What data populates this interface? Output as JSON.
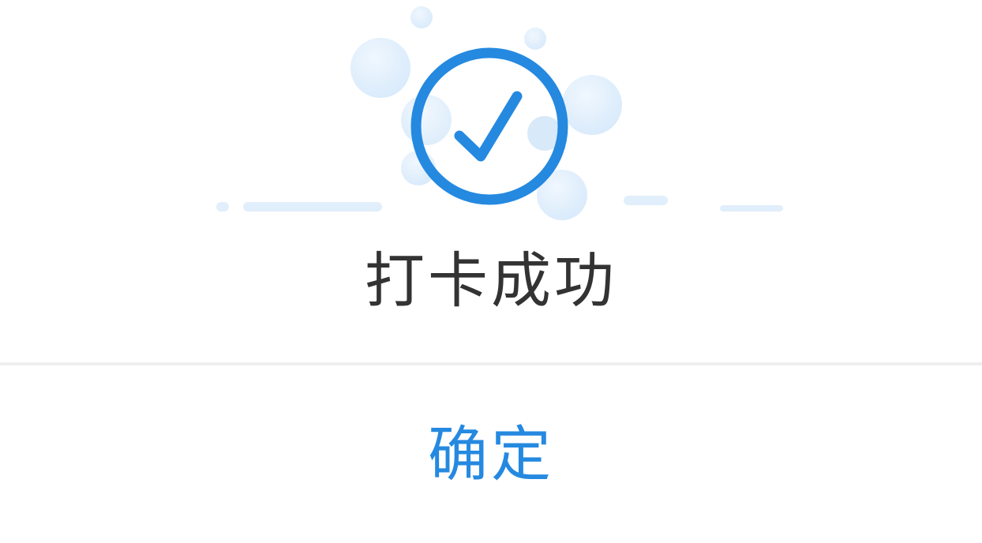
{
  "dialog": {
    "title": "打卡成功",
    "confirm_label": "确定"
  },
  "icons": {
    "success": "check-circle-icon"
  },
  "colors": {
    "accent": "#2589e0",
    "bubble_light": "#e6f2fd",
    "bubble_mid": "#d5e8fa",
    "title_text": "#333333",
    "divider": "#efefef"
  }
}
